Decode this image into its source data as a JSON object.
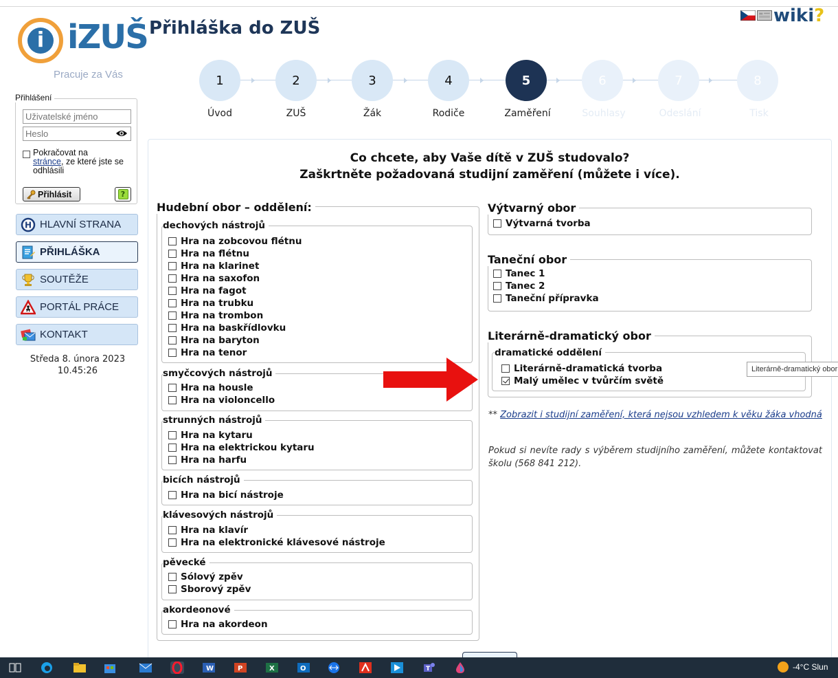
{
  "app": {
    "logo_text": "iZUŠ",
    "tagline": "Pracuje za Vás",
    "page_title": "Přihláška do ZUŠ",
    "wiki": "wiki",
    "wiki_q": "?"
  },
  "login": {
    "legend": "Přihlášení",
    "username_placeholder": "Uživatelské jméno",
    "password_placeholder": "Heslo",
    "continue_text": "Pokračovat na",
    "continue_link": "stránce",
    "continue_rest": ", ze které jste se odhlásili",
    "login_button": "Přihlásit",
    "help": "?"
  },
  "nav": [
    {
      "label": "HLAVNÍ STRANA"
    },
    {
      "label": "PŘIHLÁŠKA"
    },
    {
      "label": "SOUTĚŽE"
    },
    {
      "label": "PORTÁL PRÁCE"
    },
    {
      "label": "KONTAKT"
    }
  ],
  "datetime": {
    "date": "Středa 8. února 2023",
    "time": "10.45:26"
  },
  "steps": [
    {
      "num": "1",
      "label": "Úvod",
      "state": "done"
    },
    {
      "num": "2",
      "label": "ZUŠ",
      "state": "done"
    },
    {
      "num": "3",
      "label": "Žák",
      "state": "done"
    },
    {
      "num": "4",
      "label": "Rodiče",
      "state": "done"
    },
    {
      "num": "5",
      "label": "Zaměření",
      "state": "current"
    },
    {
      "num": "6",
      "label": "Souhlasy",
      "state": "future"
    },
    {
      "num": "7",
      "label": "Odeslání",
      "state": "future"
    },
    {
      "num": "8",
      "label": "Tisk",
      "state": "future"
    }
  ],
  "main": {
    "question": "Co chcete, aby Vaše dítě v ZUŠ studovalo?",
    "subquestion": "Zaškrtněte požadovaná studijní zaměření (můžete i více).",
    "music": {
      "legend": "Hudební obor – oddělení:",
      "groups": [
        {
          "legend": "dechových nástrojů",
          "items": [
            "Hra na zobcovou flétnu",
            "Hra na flétnu",
            "Hra na klarinet",
            "Hra na saxofon",
            "Hra na fagot",
            "Hra na trubku",
            "Hra na trombon",
            "Hra na baskřídlovku",
            "Hra na baryton",
            "Hra na tenor"
          ]
        },
        {
          "legend": "smyčcových nástrojů",
          "items": [
            "Hra na housle",
            "Hra na violoncello"
          ]
        },
        {
          "legend": "strunných nástrojů",
          "items": [
            "Hra na kytaru",
            "Hra na elektrickou kytaru",
            "Hra na harfu"
          ]
        },
        {
          "legend": "bicích nástrojů",
          "items": [
            "Hra na bicí nástroje"
          ]
        },
        {
          "legend": "klávesových nástrojů",
          "items": [
            "Hra na klavír",
            "Hra na elektronické klávesové nástroje"
          ]
        },
        {
          "legend": "pěvecké",
          "items": [
            "Sólový zpěv",
            "Sborový zpěv"
          ]
        },
        {
          "legend": "akordeonové",
          "items": [
            "Hra na akordeon"
          ]
        }
      ]
    },
    "visual": {
      "legend": "Výtvarný obor",
      "items": [
        "Výtvarná tvorba"
      ]
    },
    "dance": {
      "legend": "Taneční obor",
      "items": [
        "Tanec 1",
        "Tanec 2",
        "Taneční přípravka"
      ]
    },
    "drama": {
      "legend": "Literárně-dramatický obor",
      "sub_legend": "dramatické oddělení",
      "items": [
        {
          "label": "Literárně-dramatická tvorba",
          "checked": false
        },
        {
          "label": "Malý umělec v tvůrčím světě",
          "checked": true
        }
      ]
    },
    "tooltip": "Literárně-dramatický obor",
    "note_prefix": "** ",
    "note_link": "Zobrazit i studijní zaměření, která nejsou vzhledem k věku žáka vhodná",
    "note2": "Pokud si nevíte rady s výběrem studijního zaměření, můžete kontaktovat školu (568 841 212)."
  },
  "taskbar": {
    "weather": "-4°C  Slun"
  },
  "colors": {
    "brand_blue": "#2b6fa8",
    "brand_orange": "#f0a03a",
    "step_current": "#1d3354",
    "step_done": "#d9e8f6",
    "arrow_red": "#e8110f"
  }
}
